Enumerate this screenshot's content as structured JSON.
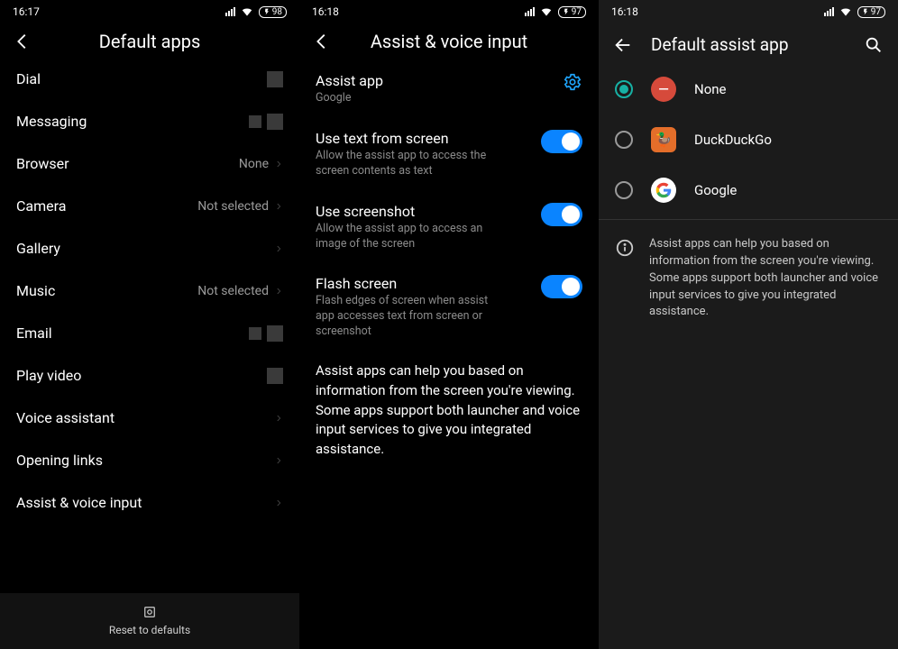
{
  "panel1": {
    "time": "16:17",
    "battery": "98",
    "title": "Default apps",
    "rows": [
      {
        "label": "Dial",
        "value": "",
        "chev": false,
        "icons": 1
      },
      {
        "label": "Messaging",
        "value": "",
        "chev": false,
        "icons": 2
      },
      {
        "label": "Browser",
        "value": "None",
        "chev": true,
        "icons": 0
      },
      {
        "label": "Camera",
        "value": "Not selected",
        "chev": true,
        "icons": 0
      },
      {
        "label": "Gallery",
        "value": "",
        "chev": true,
        "icons": 0
      },
      {
        "label": "Music",
        "value": "Not selected",
        "chev": true,
        "icons": 0
      },
      {
        "label": "Email",
        "value": "",
        "chev": false,
        "icons": 2
      },
      {
        "label": "Play video",
        "value": "",
        "chev": false,
        "icons": 1
      },
      {
        "label": "Voice assistant",
        "value": "",
        "chev": true,
        "icons": 0
      },
      {
        "label": "Opening links",
        "value": "",
        "chev": true,
        "icons": 0
      },
      {
        "label": "Assist & voice input",
        "value": "",
        "chev": true,
        "icons": 0
      }
    ],
    "reset": "Reset to defaults"
  },
  "panel2": {
    "time": "16:18",
    "battery": "97",
    "title": "Assist & voice input",
    "assist": {
      "title": "Assist app",
      "value": "Google"
    },
    "toggles": [
      {
        "title": "Use text from screen",
        "desc": "Allow the assist app to access the screen contents as text",
        "on": true
      },
      {
        "title": "Use screenshot",
        "desc": "Allow the assist app to access an image of the screen",
        "on": true
      },
      {
        "title": "Flash screen",
        "desc": "Flash edges of screen when assist app accesses text from screen or screenshot",
        "on": true
      }
    ],
    "info": "Assist apps can help you based on information from the screen you're viewing. Some apps support both launcher and voice input services to give you integrated assistance."
  },
  "panel3": {
    "time": "16:18",
    "battery": "97",
    "title": "Default assist app",
    "options": [
      {
        "label": "None",
        "selected": true,
        "icon": "none"
      },
      {
        "label": "DuckDuckGo",
        "selected": false,
        "icon": "ddg"
      },
      {
        "label": "Google",
        "selected": false,
        "icon": "google"
      }
    ],
    "info": "Assist apps can help you based on information from the screen you're viewing. Some apps support both launcher and voice input services to give you integrated assistance."
  }
}
